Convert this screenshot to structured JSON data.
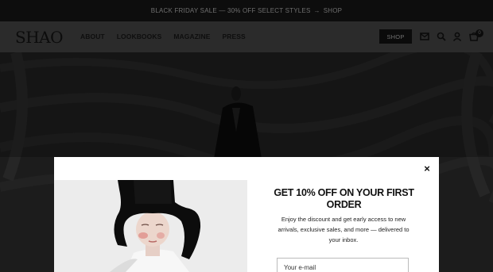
{
  "announcement": {
    "text": "BLACK FRIDAY SALE — 30% OFF SELECT STYLES",
    "arrow": "→",
    "link": "SHOP"
  },
  "header": {
    "logo": "SHAO",
    "nav": [
      "ABOUT",
      "LOOKBOOKS",
      "MAGAZINE",
      "PRESS"
    ],
    "shop_button": "SHOP",
    "cart_count": "0",
    "icons": [
      "mail-icon",
      "search-icon",
      "account-icon",
      "cart-icon"
    ]
  },
  "modal": {
    "close_glyph": "×",
    "title": "GET 10% OFF ON YOUR FIRST ORDER",
    "description": "Enjoy the discount and get early access to new arrivals, exclusive sales, and more — delivered to your inbox.",
    "email_placeholder": "Your e-mail"
  },
  "colors": {
    "announcement_bg": "#0d0d0d",
    "header_bg": "#2b2b2b",
    "overlay": "#111111",
    "modal_bg": "#ffffff"
  }
}
